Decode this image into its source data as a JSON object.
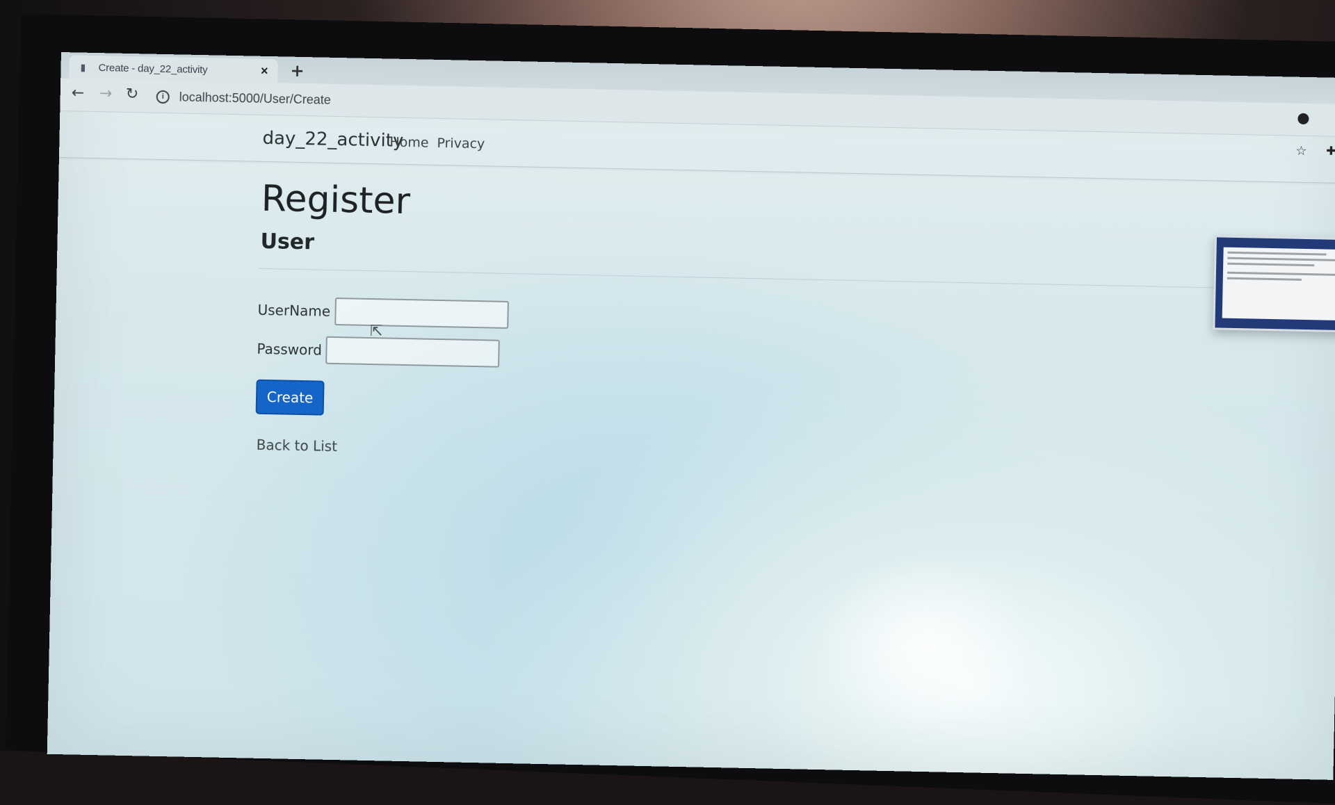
{
  "browser": {
    "tab_title": "Create - day_22_activity",
    "tab_close": "×",
    "new_tab": "+",
    "address": "localhost:5000/User/Create",
    "info_glyph": "i"
  },
  "nav": {
    "brand": "day_22_activity",
    "home": "Home",
    "privacy": "Privacy"
  },
  "page": {
    "title": "Register",
    "subtitle": "User",
    "username_label": "UserName",
    "username_value": "",
    "password_label": "Password",
    "password_value": "",
    "create_button": "Create",
    "back_link": "Back to List"
  },
  "icons": {
    "back": "arrow-left-icon",
    "forward": "arrow-right-icon",
    "reload": "reload-icon",
    "star": "star-icon",
    "extension": "puzzle-icon"
  },
  "colors": {
    "primary_button": "#1565c8",
    "text": "#1e2224"
  }
}
